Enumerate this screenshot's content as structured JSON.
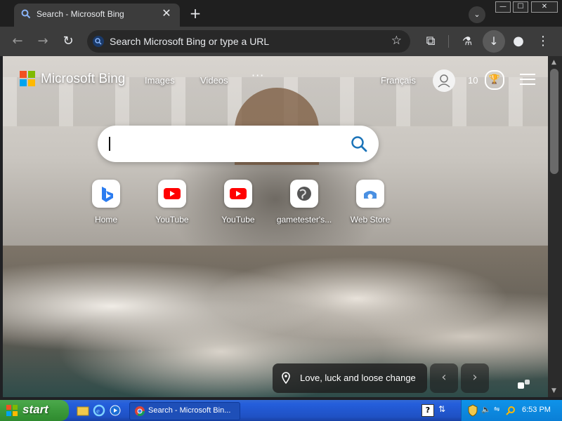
{
  "browser": {
    "tab_title": "Search - Microsoft Bing",
    "tab_close": "✕",
    "new_tab": "+",
    "tab_search": "⌄",
    "omnibox_placeholder": "Search Microsoft Bing or type a URL",
    "window_buttons": [
      "—",
      "☐",
      "✕"
    ]
  },
  "bing": {
    "brand": "Microsoft Bing",
    "nav": [
      "Images",
      "Videos"
    ],
    "more": "···",
    "language": "Français",
    "points": "10",
    "search_placeholder": "",
    "quick_links": [
      {
        "label": "Home",
        "icon": "bing-icon"
      },
      {
        "label": "YouTube",
        "icon": "youtube-icon"
      },
      {
        "label": "YouTube",
        "icon": "youtube-icon"
      },
      {
        "label": "gametester's...",
        "icon": "globe-icon"
      },
      {
        "label": "Web Store",
        "icon": "webstore-icon"
      }
    ],
    "caption": "Love, luck and loose change",
    "prev": "‹",
    "next": "›"
  },
  "taskbar": {
    "start_label": "start",
    "task_label": "Search - Microsoft Bin...",
    "help": "?",
    "clock": "6:53 PM"
  },
  "colors": {
    "chrome_dark": "#3c3c3c",
    "xp_blue": "#245edb",
    "xp_green": "#3b9a3b"
  }
}
